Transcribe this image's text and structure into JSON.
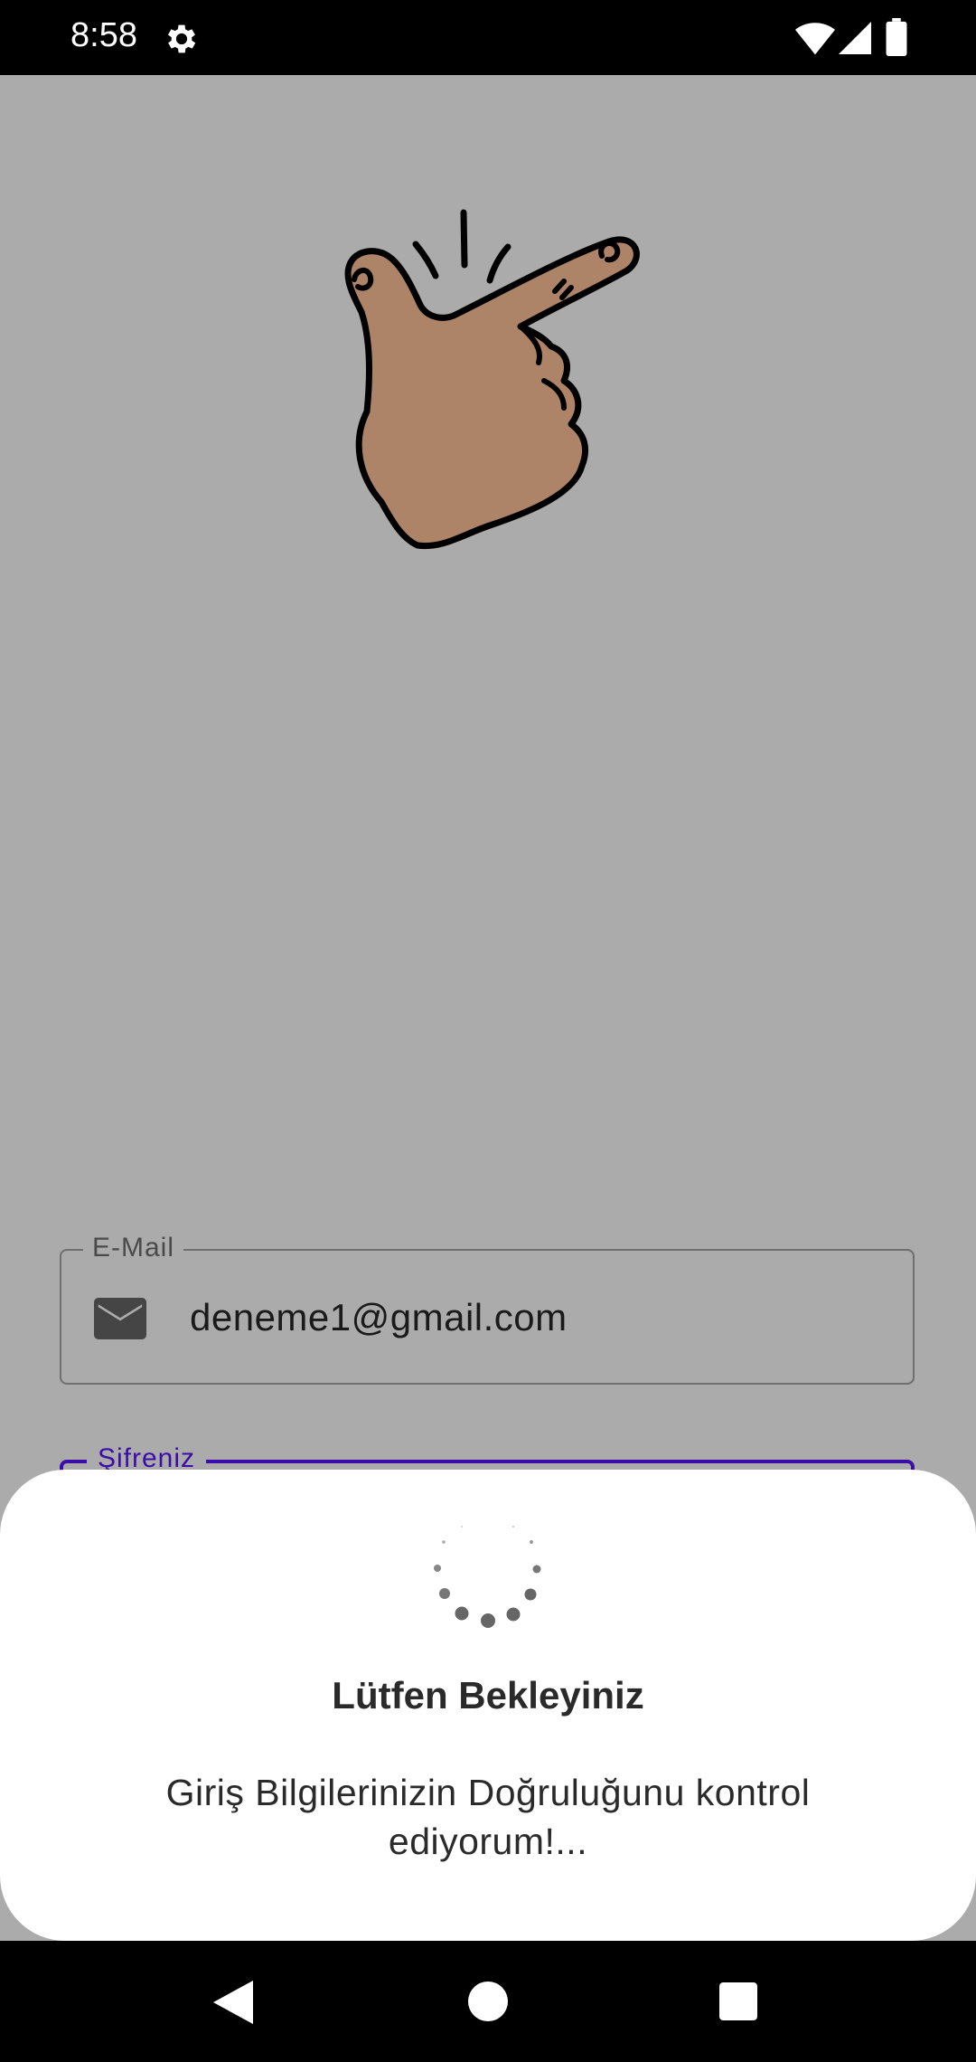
{
  "status_bar": {
    "time": "8:58",
    "settings_icon": "gear-icon",
    "wifi_icon": "wifi-icon",
    "signal_icon": "cell-signal-icon",
    "battery_icon": "battery-icon"
  },
  "illustration": {
    "icon": "finger-snap-hand-illustration",
    "skin_color": "#ad8468"
  },
  "email_field": {
    "label": "E-Mail",
    "value": "deneme1@gmail.com",
    "icon": "mail-icon"
  },
  "password_field": {
    "label": "Şifreniz"
  },
  "dialog": {
    "title": "Lütfen Bekleyiniz",
    "message": "Giriş Bilgilerinizin Doğruluğunu kontrol ediyorum!...",
    "spinner_icon": "loading-spinner-icon"
  },
  "nav_bar": {
    "back_icon": "back-icon",
    "home_icon": "home-icon",
    "recents_icon": "recents-icon"
  },
  "colors": {
    "overlay": "#ababab",
    "accent": "#3b0ea8",
    "sheet_background": "#ffffff"
  }
}
